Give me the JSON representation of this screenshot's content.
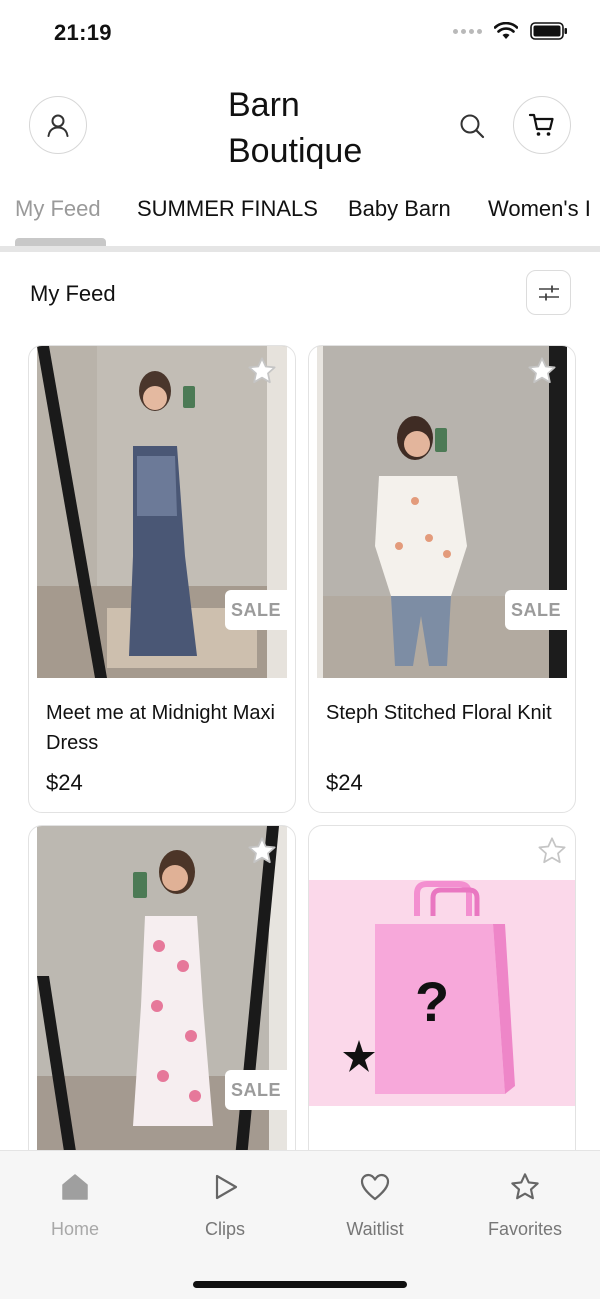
{
  "status_bar": {
    "time": "21:19"
  },
  "header": {
    "brand_line1": "Barn",
    "brand_line2": "Boutique"
  },
  "tabs": [
    {
      "label": "My Feed",
      "active": true
    },
    {
      "label": "SUMMER FINALS",
      "active": false
    },
    {
      "label": "Baby Barn",
      "active": false
    },
    {
      "label": "Women's I",
      "active": false
    }
  ],
  "section": {
    "title": "My Feed"
  },
  "products": [
    {
      "title": "Meet me at Midnight Maxi Dress",
      "price": "$24",
      "badge": "SALE"
    },
    {
      "title": "Steph Stitched Floral Knit",
      "price": "$24",
      "badge": "SALE"
    },
    {
      "badge": "SALE"
    },
    {
      "mystery_mark": "?"
    }
  ],
  "bottom_nav": [
    {
      "label": "Home",
      "icon": "home-icon"
    },
    {
      "label": "Clips",
      "icon": "play-icon"
    },
    {
      "label": "Waitlist",
      "icon": "heart-icon"
    },
    {
      "label": "Favorites",
      "icon": "star-icon"
    }
  ],
  "colors": {
    "accent_pink": "#f7a8da",
    "bag_pink": "#f38fd0",
    "muted_gray": "#9b9b9b"
  }
}
